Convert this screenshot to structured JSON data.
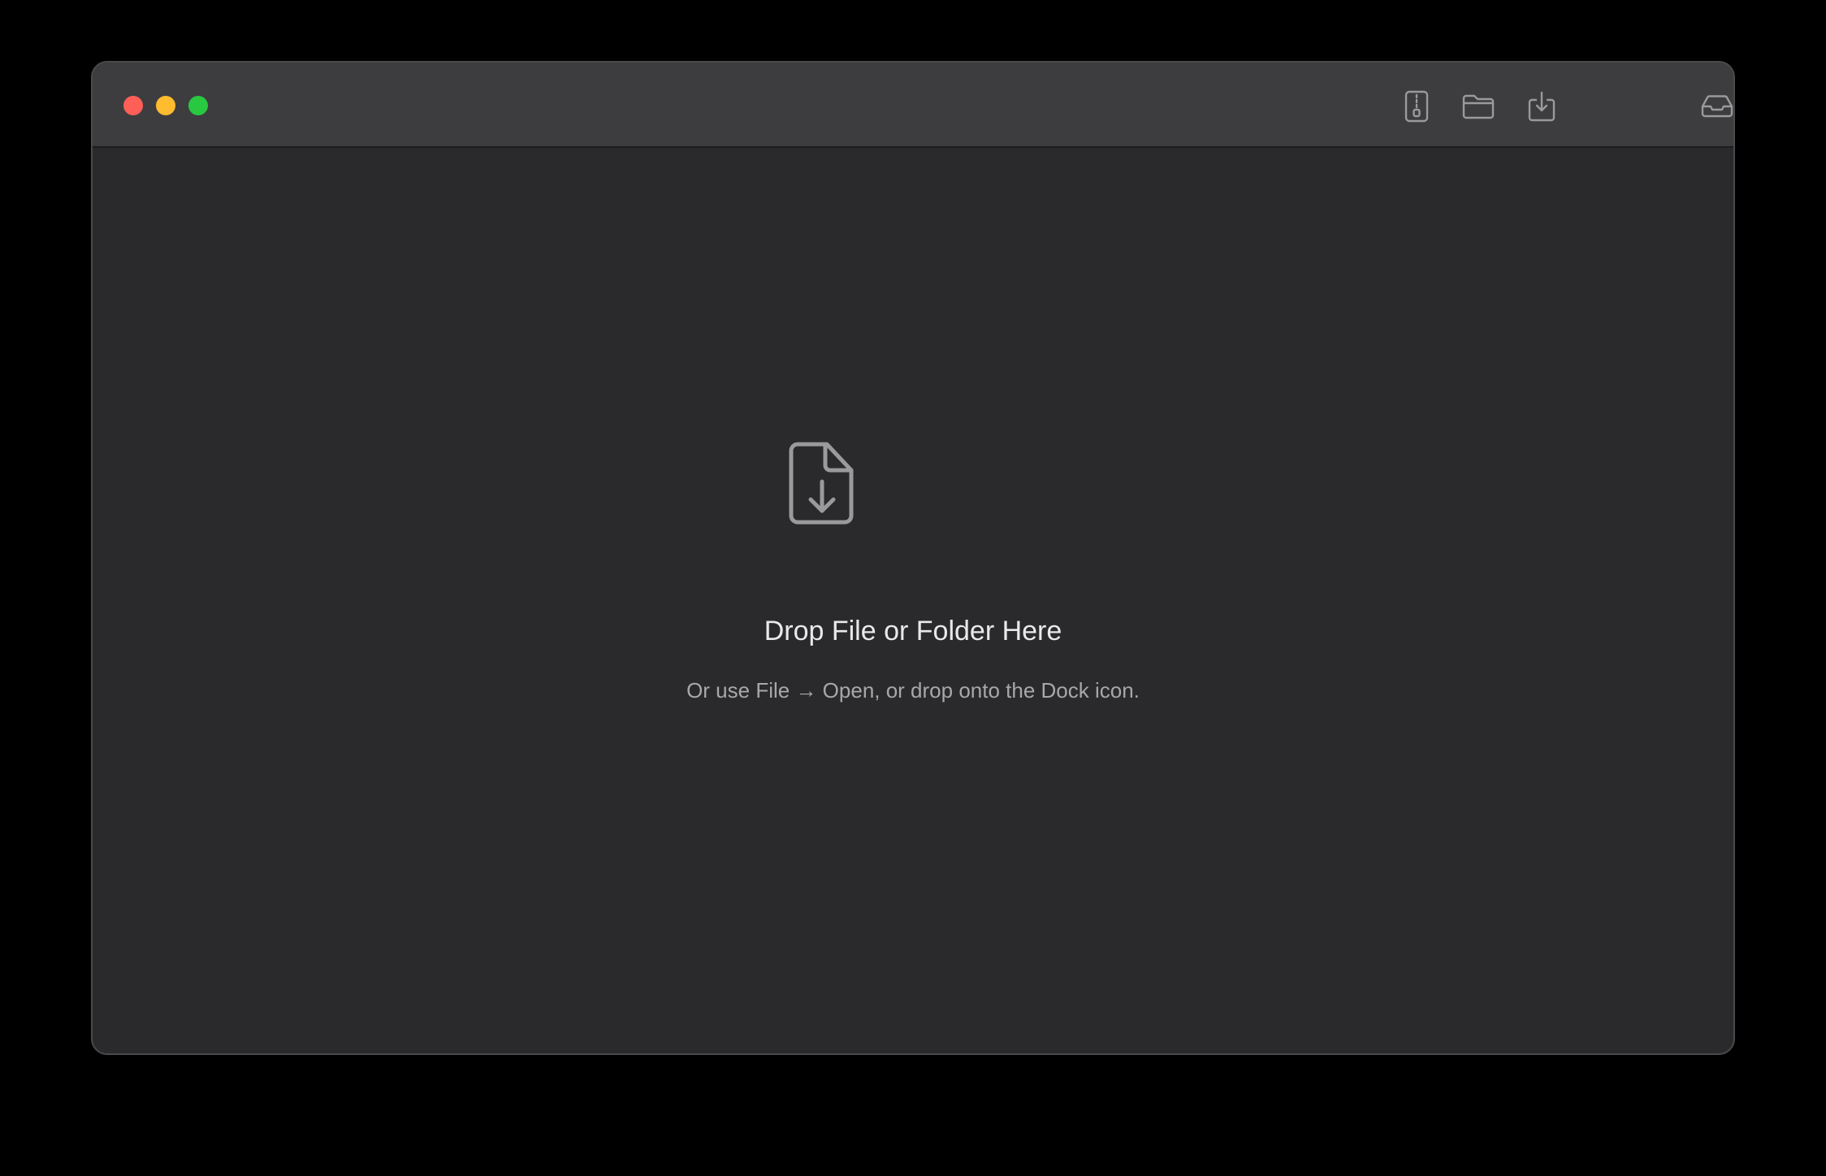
{
  "window": {
    "traffic_lights": {
      "close_color": "#ff5f57",
      "minimize_color": "#febc2e",
      "zoom_color": "#28c840"
    }
  },
  "toolbar": {
    "icons": [
      "archive-icon",
      "folder-icon",
      "download-tray-icon",
      "inbox-tray-icon",
      "gear-icon"
    ]
  },
  "dropzone": {
    "icon": "document-download-icon",
    "title": "Drop File or Folder Here",
    "subtitle": "Or use File → Open, or drop onto the Dock icon."
  },
  "colors": {
    "background": "#000000",
    "window": "#2a2a2c",
    "titlebar": "#3d3d3f",
    "icon": "#9a9a9d",
    "title_text": "#e9e9eb",
    "subtitle_text": "#a8a8ab"
  }
}
